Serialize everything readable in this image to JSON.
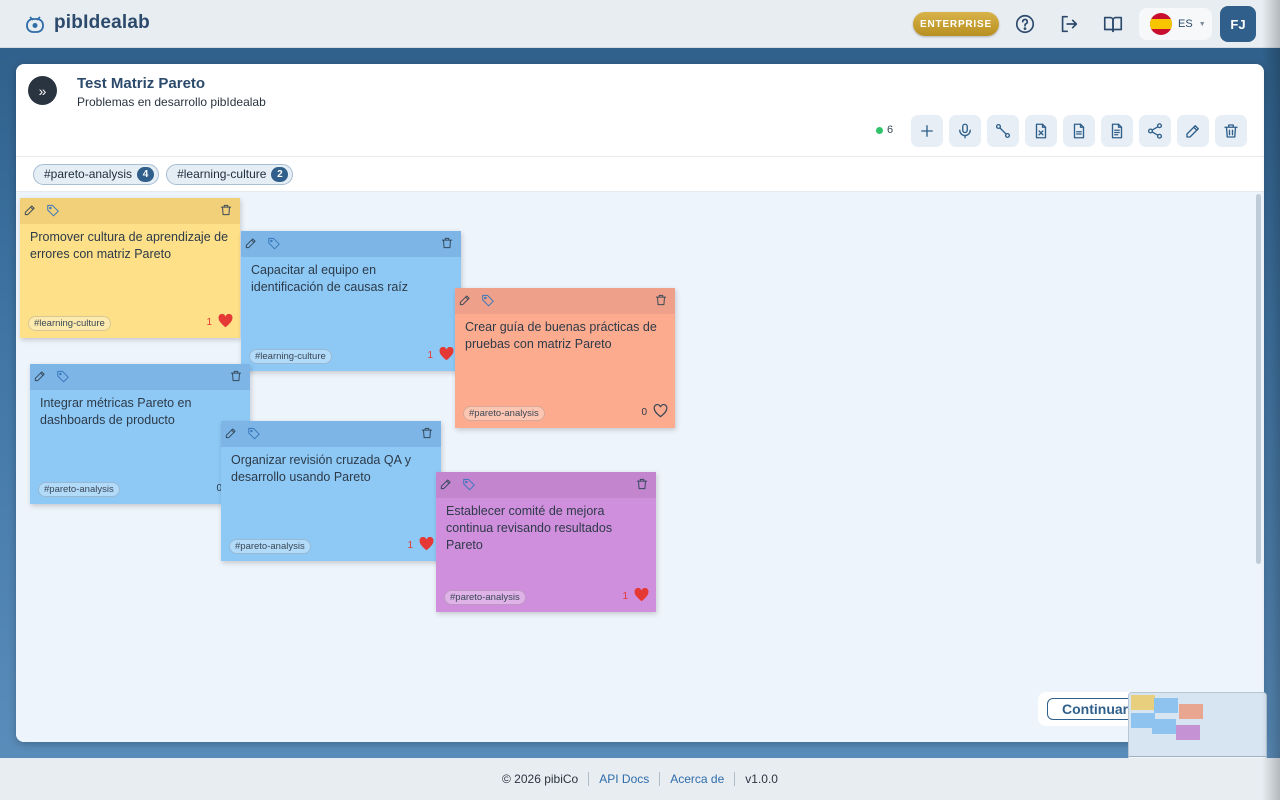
{
  "app": {
    "name": "pibIdealab"
  },
  "header": {
    "enterprise_label": "ENTERPRISE",
    "language": "ES",
    "avatar_initials": "FJ",
    "icons": [
      "help-icon",
      "logout-icon",
      "book-icon"
    ]
  },
  "board": {
    "title": "Test Matriz Pareto",
    "subtitle": "Problemas en desarrollo pibIdealab",
    "online_count": "6",
    "toolbar": [
      "add-icon",
      "microphone-icon",
      "connect-icon",
      "excel-export-icon",
      "document-icon",
      "report-icon",
      "share-icon",
      "edit-icon",
      "trash-icon"
    ]
  },
  "tag_filters": [
    {
      "label": "#pareto-analysis",
      "count": "4"
    },
    {
      "label": "#learning-culture",
      "count": "2"
    }
  ],
  "notes": [
    {
      "color": "#fde088",
      "text": "Promover cultura de aprendizaje de errores con matriz Pareto",
      "tag": "#learning-culture",
      "likes": "1",
      "liked": true
    },
    {
      "color": "#8ec9f6",
      "text": "Capacitar al equipo en identificación de causas raíz",
      "tag": "#learning-culture",
      "likes": "1",
      "liked": true
    },
    {
      "color": "#fdab8f",
      "text": "Crear guía de buenas prácticas de pruebas con matriz Pareto",
      "tag": "#pareto-analysis",
      "likes": "0",
      "liked": false
    },
    {
      "color": "#8ec9f6",
      "text": "Integrar métricas Pareto en dashboards de producto",
      "tag": "#pareto-analysis",
      "likes": "0",
      "liked": false
    },
    {
      "color": "#8ec9f6",
      "text": "Organizar revisión cruzada QA y desarrollo usando Pareto",
      "tag": "#pareto-analysis",
      "likes": "1",
      "liked": true
    },
    {
      "color": "#d08fdc",
      "text": "Establecer comité de mejora continua revisando resultados Pareto",
      "tag": "#pareto-analysis",
      "likes": "1",
      "liked": true
    }
  ],
  "continue_label": "Continuar",
  "footer": {
    "copyright": "© 2026 pibiCo",
    "api_docs": "API Docs",
    "about": "Acerca de",
    "version": "v1.0.0"
  }
}
